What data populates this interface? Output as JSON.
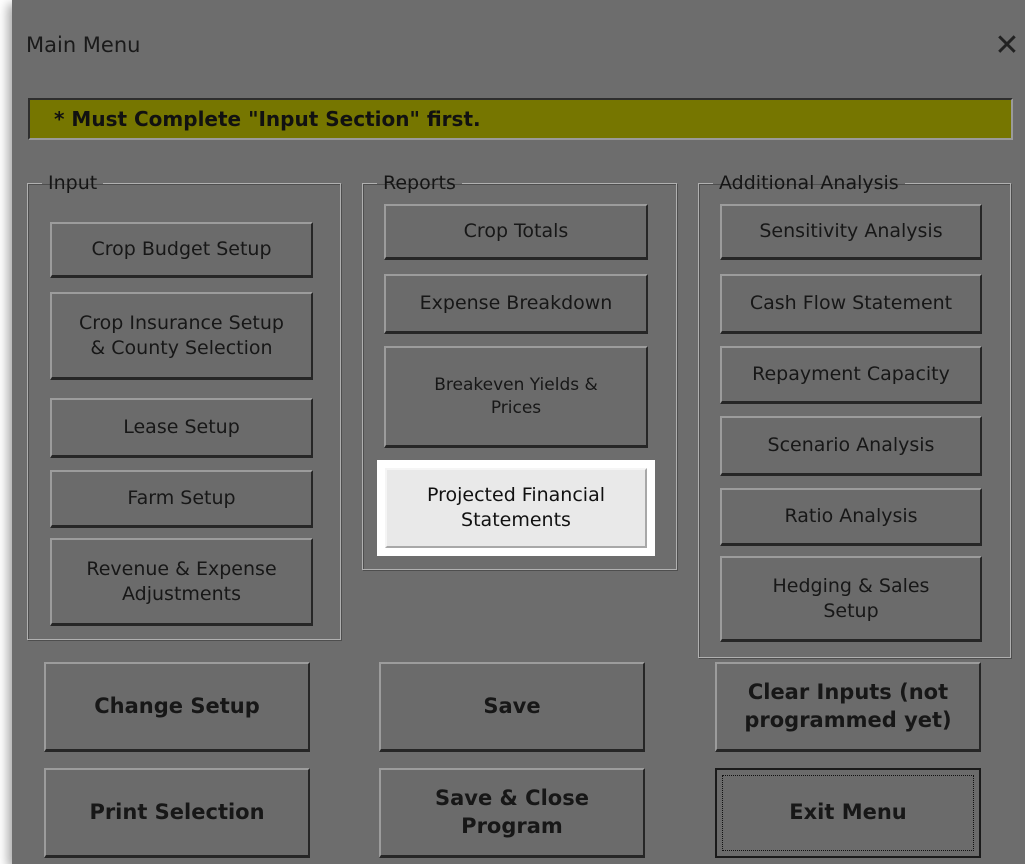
{
  "window": {
    "title": "Main Menu",
    "close_glyph": "✕"
  },
  "warning": {
    "text": "* Must Complete \"Input Section\" first."
  },
  "groups": {
    "input": {
      "legend": "Input",
      "buttons": [
        "Crop Budget Setup",
        "Crop Insurance Setup\n& County Selection",
        "Lease Setup",
        "Farm Setup",
        "Revenue & Expense\nAdjustments"
      ]
    },
    "reports": {
      "legend": "Reports",
      "buttons": [
        "Crop Totals",
        "Expense Breakdown",
        "Breakeven Yields &\nPrices",
        "Projected Financial\nStatements"
      ]
    },
    "additional": {
      "legend": "Additional Analysis",
      "buttons": [
        "Sensitivity Analysis",
        "Cash Flow Statement",
        "Repayment Capacity",
        "Scenario Analysis",
        "Ratio Analysis",
        "Hedging & Sales\nSetup"
      ]
    }
  },
  "actions": {
    "change_setup": "Change Setup",
    "save": "Save",
    "clear_inputs": "Clear Inputs (not\nprogrammed yet)",
    "print_selection": "Print Selection",
    "save_close": "Save & Close\nProgram",
    "exit_menu": "Exit Menu"
  }
}
